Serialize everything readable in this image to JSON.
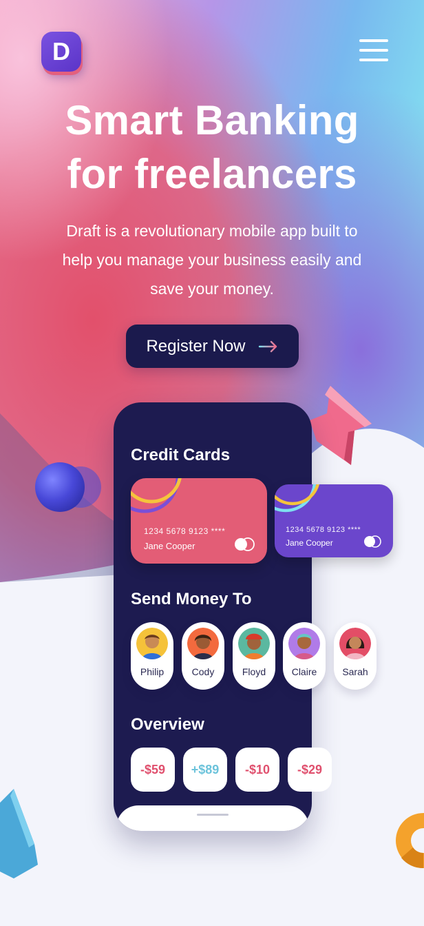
{
  "header": {
    "logo_letter": "D",
    "menu_icon": "hamburger-icon"
  },
  "hero": {
    "title_line1": "Smart Banking",
    "title_line2": "for freelancers",
    "subtitle_line1": "Draft is a revolutionary mobile app built to",
    "subtitle_line2": "help you manage your business easily and",
    "subtitle_line3": "save your money.",
    "cta_label": "Register Now",
    "cta_icon": "arrow-right-icon"
  },
  "phone": {
    "credit_cards_title": "Credit Cards",
    "cards": [
      {
        "number": "1234 5678 9123 ****",
        "holder": "Jane Cooper",
        "color": "#e35d76"
      },
      {
        "number": "1234 5678 9123 ****",
        "holder": "Jane Cooper",
        "color": "#6b46cc"
      }
    ],
    "send_money_title": "Send Money To",
    "contacts": [
      {
        "name": "Philip"
      },
      {
        "name": "Cody"
      },
      {
        "name": "Floyd"
      },
      {
        "name": "Claire"
      },
      {
        "name": "Sarah"
      }
    ],
    "overview_title": "Overview",
    "amounts": [
      {
        "value": "-$59",
        "color": "#e0506e"
      },
      {
        "value": "+$89",
        "color": "#6cc3db"
      },
      {
        "value": "-$10",
        "color": "#e0506e"
      },
      {
        "value": "-$29",
        "color": "#e0506e"
      }
    ]
  },
  "colors": {
    "navy": "#1b1a4d",
    "pink": "#e35d76",
    "purple": "#6b46cc",
    "cyan": "#7ee0f0"
  }
}
